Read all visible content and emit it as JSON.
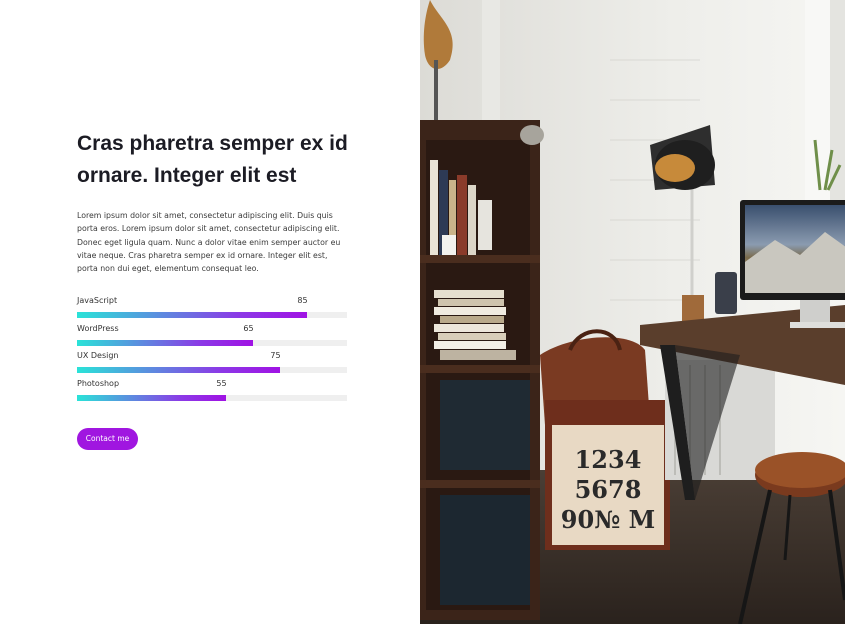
{
  "heading": "Cras pharetra semper ex id ornare. Integer elit est",
  "paragraph": "Lorem ipsum dolor sit amet, consectetur adipiscing elit. Duis quis porta eros. Lorem ipsum dolor sit amet, consectetur adipiscing elit. Donec eget ligula quam. Nunc a dolor vitae enim semper auctor eu vitae neque. Cras pharetra semper ex id ornare. Integer elit est, porta non dui eget, elementum consequat leo.",
  "skills": [
    {
      "name": "JavaScript",
      "value": "85",
      "percent": 85
    },
    {
      "name": "WordPress",
      "value": "65",
      "percent": 65
    },
    {
      "name": "UX Design",
      "value": "75",
      "percent": 75
    },
    {
      "name": "Photoshop",
      "value": "55",
      "percent": 55
    }
  ],
  "contact_button": "Contact me",
  "photo": {
    "icon": "workspace-photo",
    "box_numbers": [
      "1234",
      "5678",
      "90№ M"
    ]
  },
  "colors": {
    "gradient_start": "#2ae3d8",
    "gradient_end": "#a012e4",
    "button": "#a016e0",
    "track": "#efefef",
    "heading": "#1c1c24"
  }
}
